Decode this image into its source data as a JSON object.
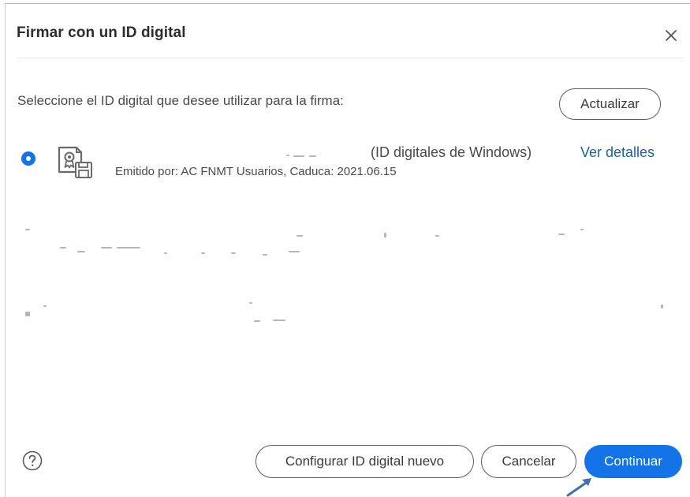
{
  "dialog": {
    "title": "Firmar con un ID digital",
    "close_icon": "close-icon"
  },
  "content": {
    "prompt": "Seleccione el ID digital que desee utilizar para la firma:",
    "refresh_label": "Actualizar",
    "certificates": [
      {
        "selected": true,
        "icon": "certificate-icon",
        "type": "(ID digitales de Windows)",
        "details_label": "Ver detalles",
        "issuer": "Emitido por: AC FNMT Usuarios, Caduca: 2021.06.15"
      }
    ]
  },
  "footer": {
    "help_icon": "help-icon",
    "new_id_label": "Configurar ID digital nuevo",
    "cancel_label": "Cancelar",
    "continue_label": "Continuar"
  },
  "colors": {
    "accent": "#1473e6",
    "link": "#1c5fa8",
    "text": "#2c2c2c",
    "border": "#5c5c5c"
  }
}
